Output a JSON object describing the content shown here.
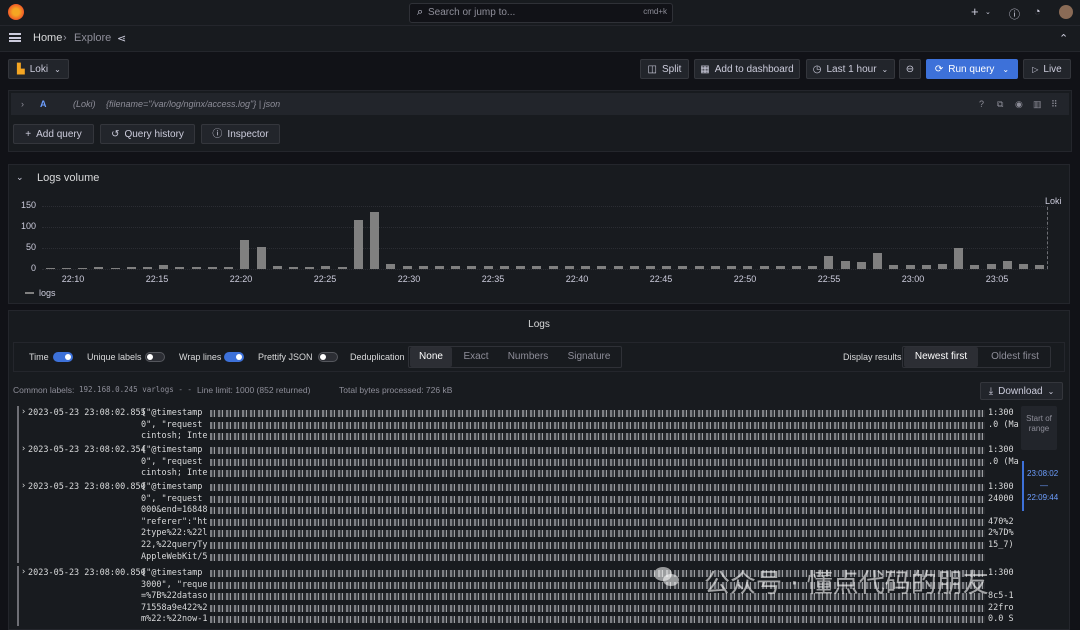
{
  "topbar": {
    "search_placeholder": "Search or jump to...",
    "search_shortcut": "cmd+k",
    "plus": "+"
  },
  "breadcrumb": {
    "home": "Home",
    "sep": "›",
    "current": "Explore"
  },
  "toolbar": {
    "datasource": "Loki",
    "split": "Split",
    "add_to_dashboard": "Add to dashboard",
    "time_range": "Last 1 hour",
    "run_query": "Run query",
    "live": "Live"
  },
  "query": {
    "ref": "A",
    "datasource": "(Loki)",
    "expr": "{filename=\"/var/log/nginx/access.log\"} | json",
    "add_query": "Add query",
    "query_history": "Query history",
    "inspector": "Inspector"
  },
  "volume": {
    "title": "Logs volume",
    "series_label": "Loki",
    "legend": "logs"
  },
  "chart_data": {
    "type": "bar",
    "y_ticks": [
      "150",
      "100",
      "50",
      "0"
    ],
    "ylim": [
      0,
      150
    ],
    "x_ticks": [
      "22:10",
      "22:15",
      "22:20",
      "22:25",
      "22:30",
      "22:35",
      "22:40",
      "22:45",
      "22:50",
      "22:55",
      "23:00",
      "23:05"
    ],
    "series": [
      {
        "name": "logs",
        "values": [
          3,
          3,
          2,
          5,
          3,
          5,
          5,
          10,
          5,
          5,
          5,
          5,
          70,
          53,
          8,
          5,
          5,
          8,
          5,
          117,
          135,
          13,
          8,
          8,
          8,
          8,
          8,
          8,
          8,
          8,
          8,
          8,
          8,
          8,
          8,
          8,
          8,
          8,
          8,
          8,
          8,
          8,
          8,
          8,
          8,
          8,
          8,
          8,
          30,
          20,
          16,
          37,
          10,
          10,
          10,
          12,
          50,
          10,
          12,
          18,
          12,
          10
        ]
      }
    ]
  },
  "logs": {
    "title": "Logs",
    "options": {
      "time": "Time",
      "unique_labels": "Unique labels",
      "wrap_lines": "Wrap lines",
      "prettify_json": "Prettify JSON",
      "dedup": "Deduplication"
    },
    "dedup_modes": [
      "None",
      "Exact",
      "Numbers",
      "Signature"
    ],
    "display_results": "Display results",
    "order": [
      "Newest first",
      "Oldest first"
    ],
    "common_labels_label": "Common labels:",
    "common_labels_value": "192.168.0.245  varlogs  -  -",
    "line_limit": "Line limit:  1000 (852 returned)",
    "bytes": "Total bytes processed:  726 kB",
    "download": "Download",
    "range_start": "Start of range",
    "range_top": "23:08:02",
    "range_dash": "—",
    "range_bottom": "22:09:44",
    "rows": [
      {
        "ts": "2023-05-23 23:08:02.855",
        "lines": [
          "{\"@timestamp",
          "0\", \"request",
          "cintosh; Inte"
        ],
        "tails": [
          "1:300",
          ".0 (Ma",
          ""
        ]
      },
      {
        "ts": "2023-05-23 23:08:02.354",
        "lines": [
          "{\"@timestamp",
          "0\", \"request",
          "cintosh; Inte"
        ],
        "tails": [
          "1:300",
          ".0 (Ma",
          ""
        ]
      },
      {
        "ts": "2023-05-23 23:08:00.850",
        "lines": [
          "{\"@timestamp",
          "0\", \"request",
          "000&end=16848",
          "\"referer\":\"ht",
          "2type%22:%22l",
          "22,%22queryTy",
          "AppleWebKit/5"
        ],
        "tails": [
          "1:300",
          "24000",
          "",
          "470%2",
          "2%7D%",
          "15_7)",
          ""
        ]
      },
      {
        "ts": "2023-05-23 23:08:00.850",
        "lines": [
          "{\"@timestamp",
          "3000\", \"reque",
          "=%7B%22dataso",
          "71558a9e422%2",
          "m%22:%22now-1"
        ],
        "tails": [
          "1:300",
          "",
          "8c5-1",
          "22fro",
          "0.0 S"
        ]
      }
    ]
  },
  "watermark": "公众号 · 懂点代码的朋友"
}
